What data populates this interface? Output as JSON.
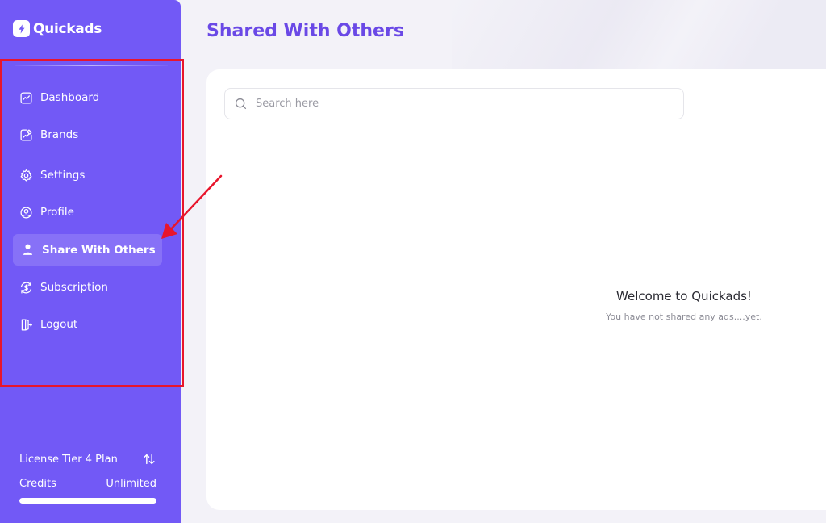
{
  "app": {
    "brand_name": "Quickads",
    "brand_icon": "quickads-logo-icon"
  },
  "sidebar": {
    "items": [
      {
        "label": "Dashboard",
        "icon": "chart-line-icon"
      },
      {
        "label": "Brands",
        "icon": "brand-edit-icon"
      },
      {
        "label": "Settings",
        "icon": "gear-icon"
      },
      {
        "label": "Profile",
        "icon": "user-circle-icon"
      },
      {
        "label": "Share With Others",
        "icon": "person-icon",
        "active": true
      },
      {
        "label": "Subscription",
        "icon": "currency-cycle-icon"
      },
      {
        "label": "Logout",
        "icon": "logout-icon"
      }
    ],
    "plan_label": "License Tier 4 Plan",
    "plan_icon": "swap-vertical-icon",
    "credits_label": "Credits",
    "credits_value": "Unlimited",
    "credits_progress": 1.0
  },
  "main": {
    "title": "Shared With Others",
    "search": {
      "placeholder": "Search here",
      "value": ""
    },
    "empty_state": {
      "title": "Welcome to Quickads!",
      "subtitle": "You have not shared any ads....yet."
    }
  },
  "colors": {
    "sidebar_bg": "#7259f6",
    "accent_title": "#6a49e6",
    "annotation_red": "#e8152c",
    "page_bg": "#f3f2f8"
  }
}
